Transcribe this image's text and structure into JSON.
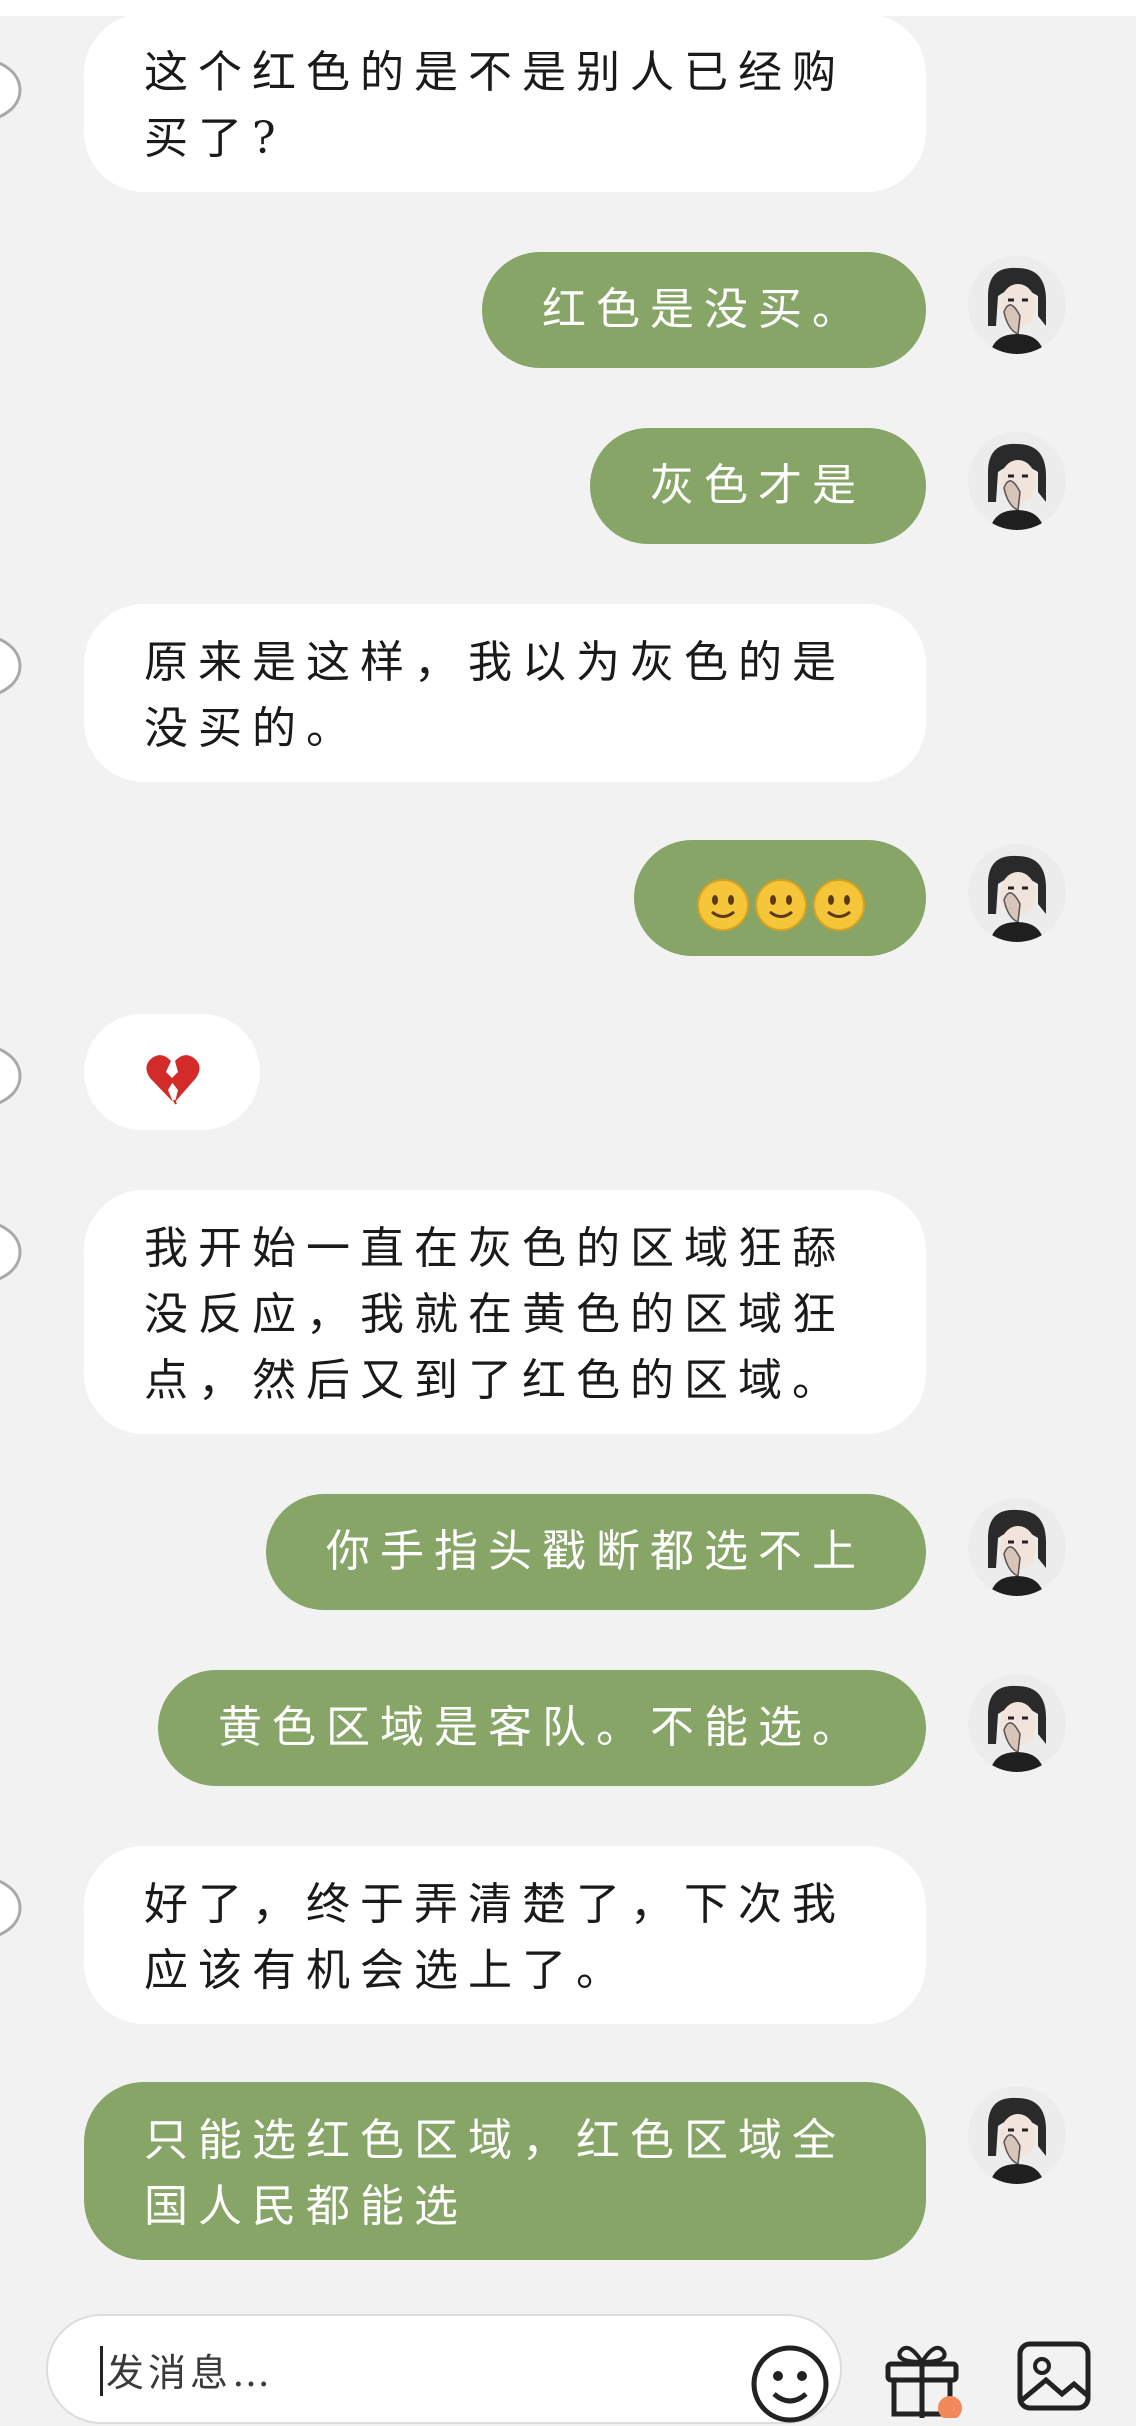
{
  "messages": [
    {
      "side": "in",
      "text": "这个红色的是不是别人已经购买了?"
    },
    {
      "side": "out",
      "text": "红色是没买。"
    },
    {
      "side": "out",
      "text": "灰色才是"
    },
    {
      "side": "in",
      "text": "原来是这样，我以为灰色的是没买的。"
    },
    {
      "side": "out",
      "emoji": "slightly-smiling-face x3"
    },
    {
      "side": "in",
      "emoji": "broken-heart"
    },
    {
      "side": "in",
      "text": "我开始一直在灰色的区域狂舔没反应，我就在黄色的区域狂点，然后又到了红色的区域。"
    },
    {
      "side": "out",
      "text": "你手指头戳断都选不上"
    },
    {
      "side": "out",
      "text": "黄色区域是客队。不能选。"
    },
    {
      "side": "in",
      "text": "好了，终于弄清楚了，下次我应该有机会选上了。"
    },
    {
      "side": "out",
      "text": "只能选红色区域，红色区域全国人民都能选"
    }
  ],
  "input": {
    "placeholder": "发消息…"
  },
  "icons": {
    "emoji_button": "smiley-icon",
    "gift_button": "gift-icon",
    "image_button": "image-icon"
  },
  "colors": {
    "background": "#f2f2f2",
    "incoming_bubble": "#ffffff",
    "outgoing_bubble": "#86a567",
    "outgoing_text": "#ffffff",
    "incoming_text": "#1a1a1a"
  }
}
